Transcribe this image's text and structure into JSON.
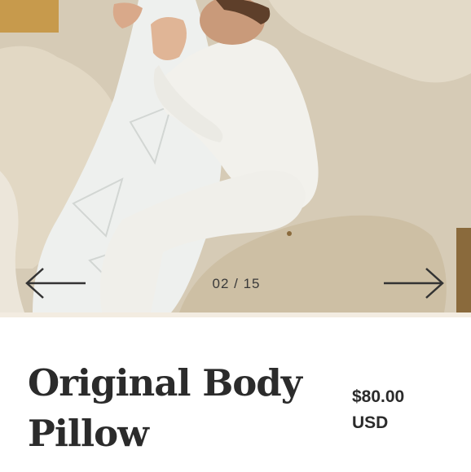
{
  "carousel": {
    "counter": "02 / 15",
    "prev_icon": "arrow-left-icon",
    "next_icon": "arrow-right-icon"
  },
  "product": {
    "title": "Original Body Pillow",
    "price_amount": "$80.00",
    "price_currency": "USD"
  },
  "colors": {
    "text": "#2b2b2b",
    "sheet": "#d3c8b3",
    "divider": "#f3ece1"
  }
}
